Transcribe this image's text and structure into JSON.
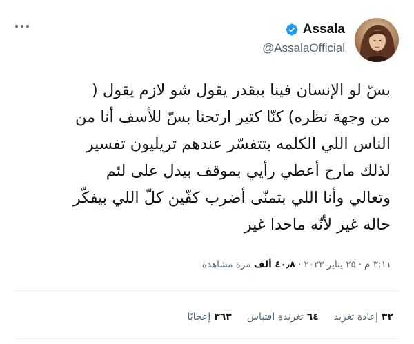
{
  "user": {
    "display_name": "Assala",
    "handle": "@AssalaOfficial",
    "verified_icon": "verified-badge-icon",
    "accent": "#1d9bf0"
  },
  "tweet": {
    "lines": [
      "بسّ لو الإنسان فينا بيقدر يقول شو لازم يقول (",
      "من وجهة نظره) كنّا كتير ارتحنا بسّ للأسف أنا من",
      "الناس اللي الكلمه بتتفسّر عندهم تريليون تفسير",
      "لذلك مارح أعطي رأيي بموقف بيدل على لئم",
      "وتعالي وأنا اللي بتمنّى أضرب كفّين كلّ اللي بيفكّر",
      "حاله غير لأنّه ماحدا غير"
    ]
  },
  "meta": {
    "time": "٣:١١ م",
    "date": "٢٥ يناير ٢٠٢٣",
    "views_count": "٤٠٫٨ ألف",
    "views_label": "مرة مشاهدة"
  },
  "stats": {
    "retweets_count": "٣٢",
    "retweets_label": "إعادة تغريد",
    "quotes_count": "٦٤",
    "quotes_label": "تغريدة اقتباس",
    "likes_count": "٣٦٣",
    "likes_label": "إعجابًا"
  },
  "icons": {
    "more": "more-options-icon"
  }
}
